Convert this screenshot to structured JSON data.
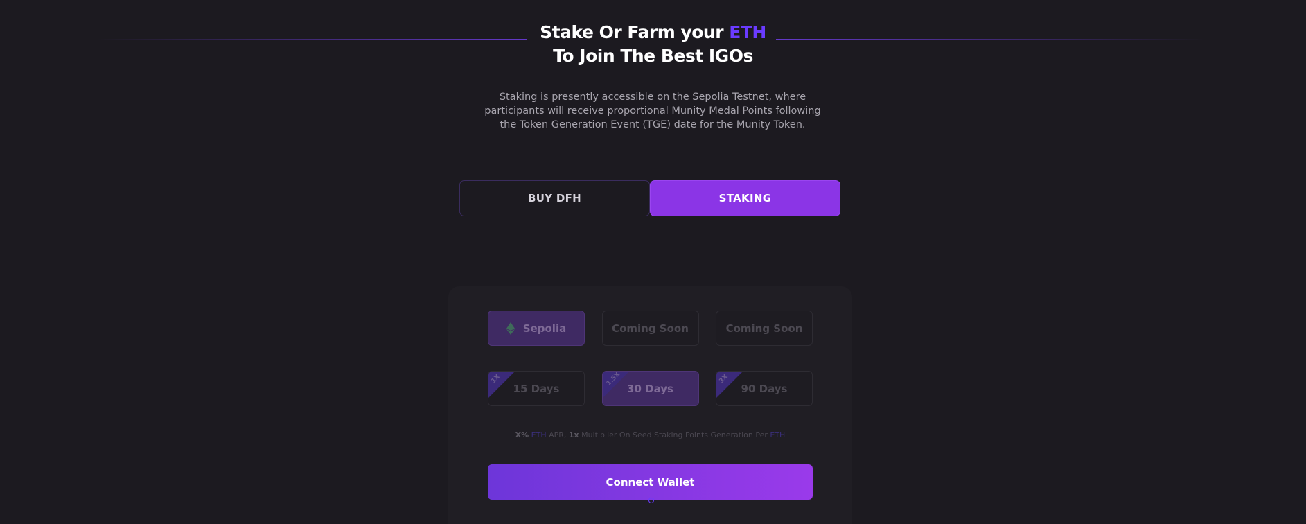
{
  "hero": {
    "title_prefix": "Stake Or Farm your ",
    "title_accent": "ETH",
    "title_line2": "To Join The Best IGOs",
    "subtitle": "Staking is presently accessible on the Sepolia Testnet, where participants will receive proportional Munity Medal Points following the Token Generation Event (TGE) date for the Munity Token."
  },
  "mode_tabs": [
    {
      "label": "BUY DFH",
      "active": false
    },
    {
      "label": "STAKING",
      "active": true
    }
  ],
  "networks": [
    {
      "label": "Sepolia",
      "icon": "ethereum-icon",
      "selected": true
    },
    {
      "label": "Coming Soon",
      "selected": false
    },
    {
      "label": "Coming Soon",
      "selected": false
    }
  ],
  "durations": [
    {
      "label": "15 Days",
      "multiplier": "1X",
      "selected": false
    },
    {
      "label": "30 Days",
      "multiplier": "1.5X",
      "selected": true
    },
    {
      "label": "90 Days",
      "multiplier": "3X",
      "selected": false
    }
  ],
  "apr": {
    "rate": "X%",
    "token": "ETH",
    "apr_text": " APR, ",
    "multiplier": "1x",
    "middle_text": " Multiplier On Seed Staking Points Generation Per ",
    "token_end": "ETH"
  },
  "connect_label": "Connect Wallet",
  "colors": {
    "background": "#1c1a20",
    "accent": "#6a3bff",
    "primary_button": "#8b35e6"
  }
}
